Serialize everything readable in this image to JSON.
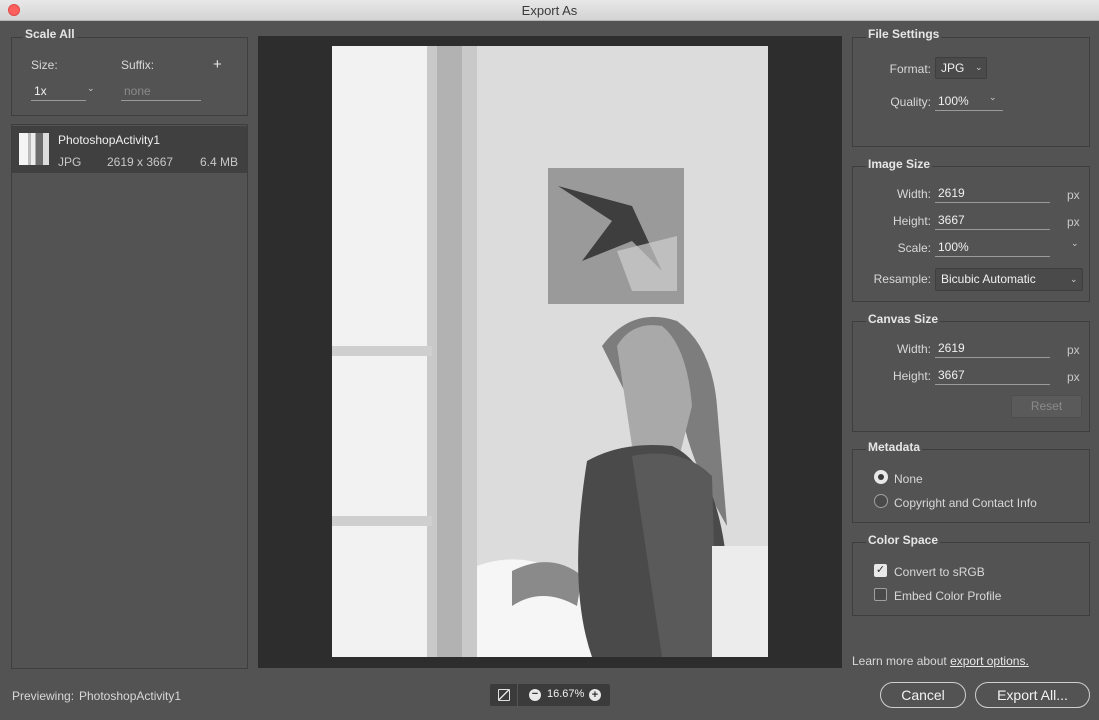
{
  "window": {
    "title": "Export As"
  },
  "scale_all": {
    "title": "Scale All",
    "size_label": "Size:",
    "suffix_label": "Suffix:",
    "add_symbol": "+",
    "size_value": "1x",
    "suffix_placeholder": "none"
  },
  "asset": {
    "name": "PhotoshopActivity1",
    "format": "JPG",
    "dimensions": "2619 x 3667",
    "filesize": "6.4 MB"
  },
  "file_settings": {
    "title": "File Settings",
    "format_label": "Format:",
    "format_value": "JPG",
    "quality_label": "Quality:",
    "quality_value": "100%"
  },
  "image_size": {
    "title": "Image Size",
    "width_label": "Width:",
    "width_value": "2619",
    "height_label": "Height:",
    "height_value": "3667",
    "scale_label": "Scale:",
    "scale_value": "100%",
    "resample_label": "Resample:",
    "resample_value": "Bicubic Automatic",
    "unit": "px"
  },
  "canvas_size": {
    "title": "Canvas Size",
    "width_label": "Width:",
    "width_value": "2619",
    "height_label": "Height:",
    "height_value": "3667",
    "unit": "px",
    "reset_label": "Reset"
  },
  "metadata": {
    "title": "Metadata",
    "options": [
      "None",
      "Copyright and Contact Info"
    ],
    "selected": "None"
  },
  "color_space": {
    "title": "Color Space",
    "convert_label": "Convert to sRGB",
    "convert_checked": true,
    "embed_label": "Embed Color Profile",
    "embed_checked": false
  },
  "footer": {
    "learn_more_prefix": "Learn more about ",
    "learn_more_link": "export options.",
    "previewing_label": "Previewing:",
    "previewing_name": "PhotoshopActivity1",
    "zoom_value": "16.67%",
    "cancel_label": "Cancel",
    "export_label": "Export All..."
  },
  "icons": {
    "close": "close-dot-icon",
    "zoom_fit": "fit-screen-icon",
    "zoom_out": "minus-circle-icon",
    "zoom_in": "plus-circle-icon",
    "dropdown": "chevron-down-icon"
  },
  "colors": {
    "background": "#535353",
    "preview_bg": "#2d2d2d",
    "close_button": "#fc605c"
  }
}
